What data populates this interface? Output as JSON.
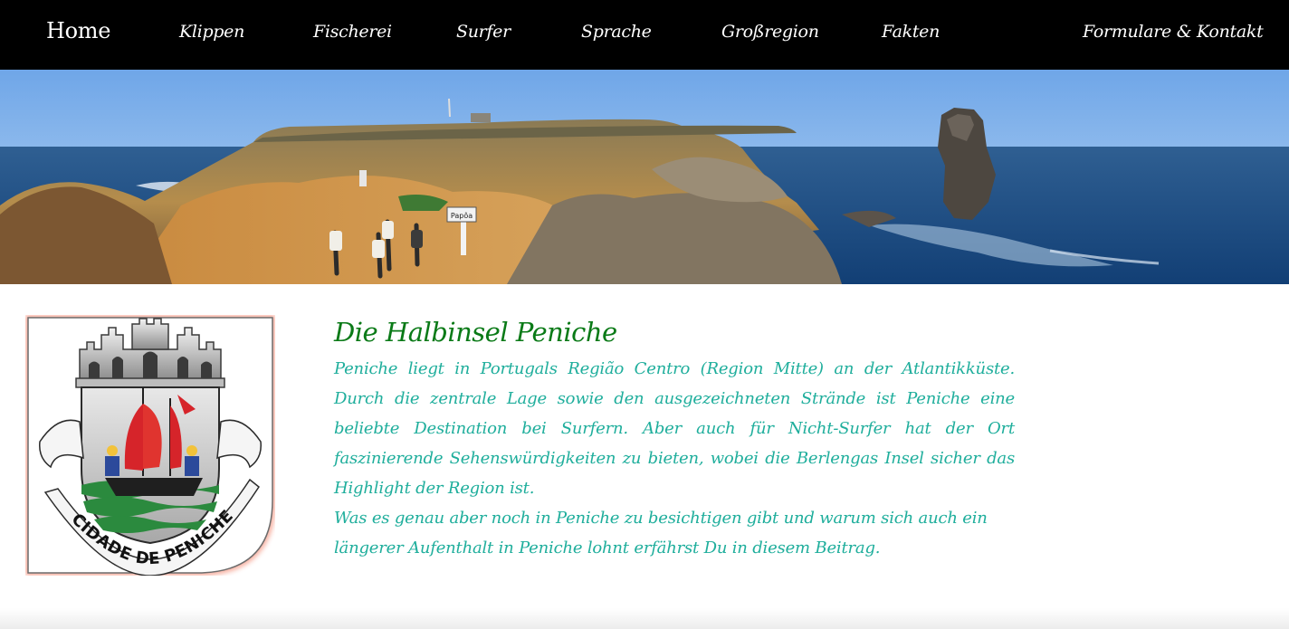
{
  "nav": {
    "items": [
      {
        "label": "Home"
      },
      {
        "label": "Klippen"
      },
      {
        "label": "Fischerei"
      },
      {
        "label": "Surfer"
      },
      {
        "label": "Sprache"
      },
      {
        "label": "Großregion"
      },
      {
        "label": "Fakten"
      },
      {
        "label": "Formulare & Kontakt"
      }
    ]
  },
  "banner": {
    "sign_text": "Papôa"
  },
  "crest": {
    "motto": "CIDADE DE PENICHE"
  },
  "article": {
    "title": "Die Halbinsel Peniche",
    "paragraph1": "Peniche liegt in Portugals Região Centro (Region Mitte) an der Atlantikküste. Durch die zentrale Lage sowie den ausgezeichneten Strände ist Peniche eine beliebte Destination bei Surfern. Aber auch für Nicht-Surfer hat der Ort faszinierende Sehenswürdigkeiten zu bieten, wobei die Berlengas Insel sicher das Highlight der Region ist.",
    "paragraph2": "Was es genau aber noch in Peniche zu besichtigen gibt und warum sich auch ein längerer Aufenthalt in Peniche lohnt erfährst Du in diesem Beitrag."
  }
}
